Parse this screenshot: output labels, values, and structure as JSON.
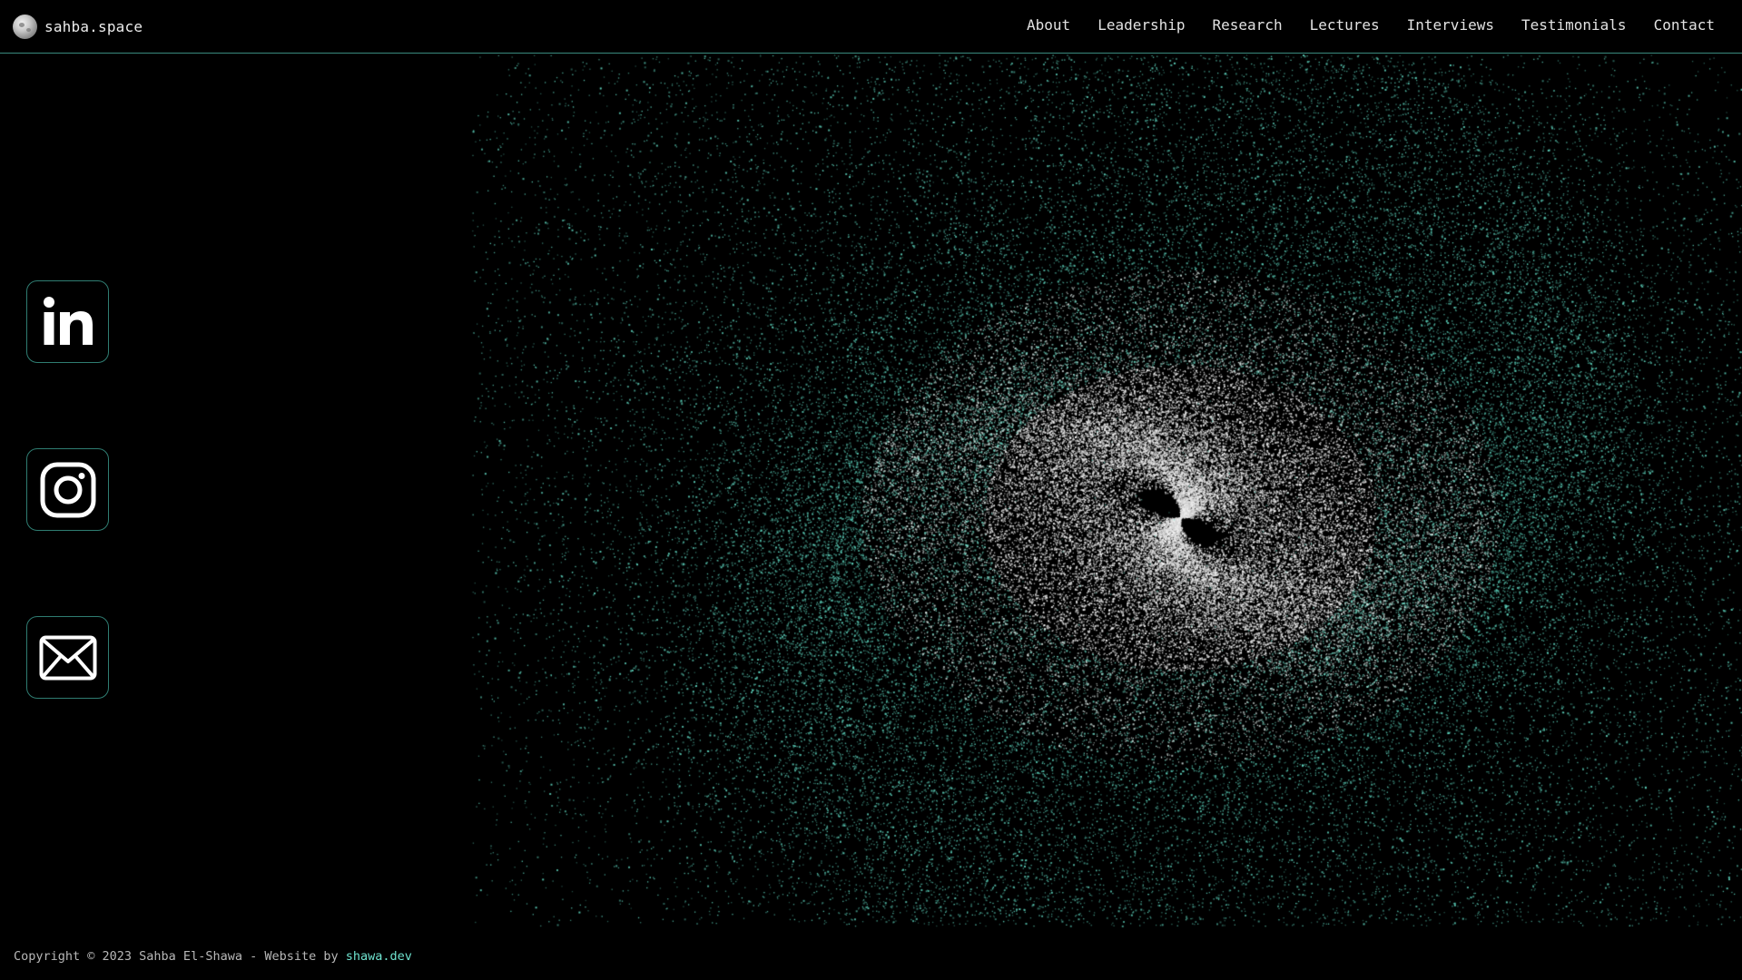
{
  "header": {
    "brand": "sahba.space",
    "nav": [
      "About",
      "Leadership",
      "Research",
      "Lectures",
      "Interviews",
      "Testimonials",
      "Contact"
    ]
  },
  "social": {
    "items": [
      {
        "icon": "linkedin-icon"
      },
      {
        "icon": "instagram-icon"
      },
      {
        "icon": "mail-icon"
      }
    ]
  },
  "footer": {
    "copyright": "Copyright © 2023 Sahba El-Shawa - Website by ",
    "link_text": "shawa.dev"
  },
  "colors": {
    "accent": "#6fe3cf",
    "border": "#2f7d72",
    "particle": "#5fd6c0",
    "background": "#000000"
  }
}
